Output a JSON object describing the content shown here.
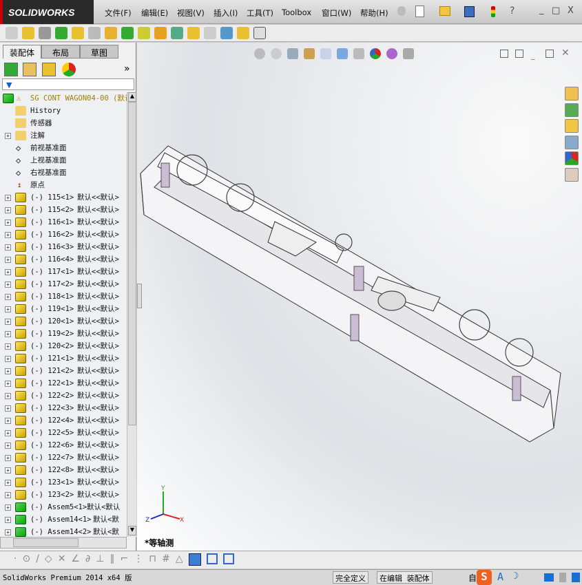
{
  "app": {
    "logo": "SOLIDWORKS"
  },
  "menu": [
    "文件(F)",
    "编辑(E)",
    "视图(V)",
    "插入(I)",
    "工具(T)",
    "Toolbox",
    "窗口(W)",
    "帮助(H)"
  ],
  "window_controls": {
    "help": "?",
    "minimize": "_",
    "restore": "□",
    "close": "X"
  },
  "panel": {
    "tabs": [
      "装配体",
      "布局",
      "草图"
    ],
    "expand": "»"
  },
  "tree": {
    "root": "SG CONT WAGON04-00  (默认",
    "fixed": [
      {
        "label": "History",
        "icon": "history-folder-icon"
      },
      {
        "label": "传感器",
        "icon": "sensor-folder-icon"
      },
      {
        "label": "注解",
        "icon": "annotation-folder-icon",
        "expand": true
      },
      {
        "label": "前视基准面",
        "icon": "plane-icon"
      },
      {
        "label": "上视基准面",
        "icon": "plane-icon"
      },
      {
        "label": "右视基准面",
        "icon": "plane-icon"
      },
      {
        "label": "原点",
        "icon": "origin-icon"
      }
    ],
    "components": [
      {
        "name": "(-) 115<1>",
        "config": "默认<<默认>",
        "type": "part"
      },
      {
        "name": "(-) 115<2>",
        "config": "默认<<默认>",
        "type": "part"
      },
      {
        "name": "(-) 116<1>",
        "config": "默认<<默认>",
        "type": "part"
      },
      {
        "name": "(-) 116<2>",
        "config": "默认<<默认>",
        "type": "part"
      },
      {
        "name": "(-) 116<3>",
        "config": "默认<<默认>",
        "type": "part"
      },
      {
        "name": "(-) 116<4>",
        "config": "默认<<默认>",
        "type": "part"
      },
      {
        "name": "(-) 117<1>",
        "config": "默认<<默认>",
        "type": "part"
      },
      {
        "name": "(-) 117<2>",
        "config": "默认<<默认>",
        "type": "part"
      },
      {
        "name": "(-) 118<1>",
        "config": "默认<<默认>",
        "type": "part"
      },
      {
        "name": "(-) 119<1>",
        "config": "默认<<默认>",
        "type": "part"
      },
      {
        "name": "(-) 120<1>",
        "config": "默认<<默认>",
        "type": "part"
      },
      {
        "name": "(-) 119<2>",
        "config": "默认<<默认>",
        "type": "part"
      },
      {
        "name": "(-) 120<2>",
        "config": "默认<<默认>",
        "type": "part"
      },
      {
        "name": "(-) 121<1>",
        "config": "默认<<默认>",
        "type": "part"
      },
      {
        "name": "(-) 121<2>",
        "config": "默认<<默认>",
        "type": "part"
      },
      {
        "name": "(-) 122<1>",
        "config": "默认<<默认>",
        "type": "part"
      },
      {
        "name": "(-) 122<2>",
        "config": "默认<<默认>",
        "type": "part"
      },
      {
        "name": "(-) 122<3>",
        "config": "默认<<默认>",
        "type": "part"
      },
      {
        "name": "(-) 122<4>",
        "config": "默认<<默认>",
        "type": "part"
      },
      {
        "name": "(-) 122<5>",
        "config": "默认<<默认>",
        "type": "part"
      },
      {
        "name": "(-) 122<6>",
        "config": "默认<<默认>",
        "type": "part"
      },
      {
        "name": "(-) 122<7>",
        "config": "默认<<默认>",
        "type": "part"
      },
      {
        "name": "(-) 122<8>",
        "config": "默认<<默认>",
        "type": "part"
      },
      {
        "name": "(-) 123<1>",
        "config": "默认<<默认>",
        "type": "part"
      },
      {
        "name": "(-) 123<2>",
        "config": "默认<<默认>",
        "type": "part"
      },
      {
        "name": "(-) Assem5<1>",
        "config": "默认<默认",
        "type": "assembly"
      },
      {
        "name": "(-) Assem14<1>",
        "config": "默认<默",
        "type": "assembly"
      },
      {
        "name": "(-) Assem14<2>",
        "config": "默认<默",
        "type": "assembly"
      }
    ]
  },
  "viewport": {
    "view_label": "*等轴测",
    "triad": {
      "x": "X",
      "y": "Y",
      "z": "Z"
    }
  },
  "status": {
    "product": "SolidWorks Premium 2014 x64 版",
    "definition": "完全定义",
    "mode": "在编辑 装配体",
    "custom": "自"
  }
}
